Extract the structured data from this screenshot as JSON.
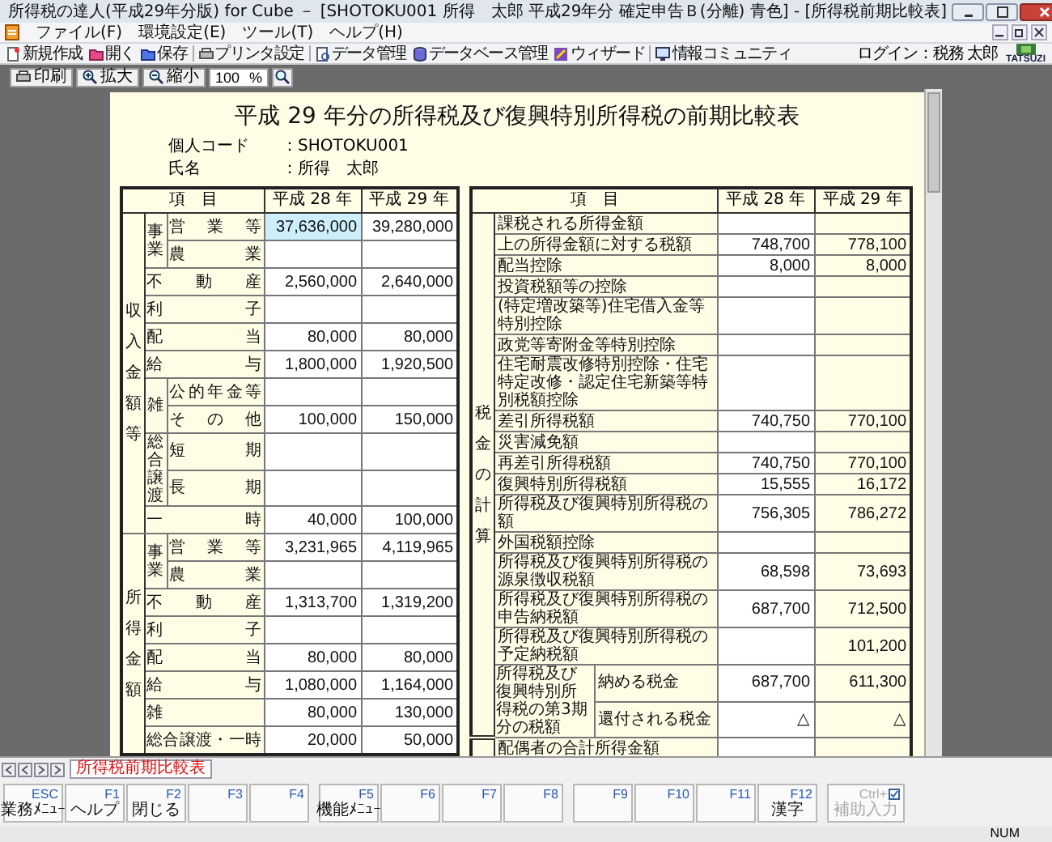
{
  "window": {
    "title": "所得税の達人(平成29年分版) for Cube － [SHOTOKU001 所得　太郎 平成29年分 確定申告Ｂ(分離) 青色] - [所得税前期比較表]"
  },
  "menu": [
    "ファイル(F)",
    "環境設定(E)",
    "ツール(T)",
    "ヘルプ(H)"
  ],
  "toolbar": {
    "groups": [
      {
        "items": [
          "新規作成",
          "開く",
          "保存"
        ]
      },
      {
        "items": [
          "プリンタ設定"
        ]
      },
      {
        "items": [
          "データ管理",
          "データベース管理",
          "ウィザード"
        ]
      },
      {
        "items": [
          "情報コミュニティ"
        ]
      }
    ],
    "login": "ログイン：税務 太郎",
    "logo": "TATSUZI"
  },
  "view_toolbar": {
    "buttons": [
      "印刷",
      "拡大",
      "縮小"
    ],
    "zoom": "100",
    "unit": "%"
  },
  "report": {
    "title": "平成 29 年分の所得税及び復興特別所得税の前期比較表",
    "info": [
      {
        "label": "個人コード",
        "value": "：SHOTOKU001"
      },
      {
        "label": "氏名",
        "value": "：所得　太郎"
      }
    ],
    "left_table": {
      "columns": [
        "項　目",
        "平成 28 年",
        "平成 29 年"
      ],
      "sections": [
        {
          "label": "収入金額等",
          "rows": [
            {
              "kind": "group",
              "label": "事業",
              "rows": [
                {
                  "item": "営業等",
                  "year_28": "37,636,000",
                  "year_29": "39,280,000",
                  "selected": true
                },
                {
                  "item": "農業",
                  "selected": false
                }
              ]
            },
            {
              "kind": "single",
              "item": "不動産",
              "year_28": "2,560,000",
              "year_29": "2,640,000",
              "selected": false
            },
            {
              "kind": "single",
              "item": "利子",
              "selected": false
            },
            {
              "kind": "single",
              "item": "配当",
              "year_28": "80,000",
              "year_29": "80,000",
              "selected": false
            },
            {
              "kind": "single",
              "item": "給与",
              "year_28": "1,800,000",
              "year_29": "1,920,500",
              "selected": false
            },
            {
              "kind": "group",
              "label": "雑",
              "rows": [
                {
                  "item": "公的年金等",
                  "selected": false
                },
                {
                  "item": "その他",
                  "year_28": "100,000",
                  "year_29": "150,000",
                  "selected": false
                }
              ]
            },
            {
              "kind": "group",
              "label": "総合譲渡",
              "rows": [
                {
                  "item": "短期",
                  "selected": false
                },
                {
                  "item": "長期",
                  "selected": false
                }
              ]
            },
            {
              "kind": "single",
              "item": "一時",
              "year_28": "40,000",
              "year_29": "100,000",
              "selected": false
            }
          ]
        },
        {
          "label": "所得金額",
          "rows": [
            {
              "kind": "group",
              "label": "事業",
              "rows": [
                {
                  "item": "営業等",
                  "year_28": "3,231,965",
                  "year_29": "4,119,965",
                  "selected": false
                },
                {
                  "item": "農業",
                  "selected": false
                }
              ]
            },
            {
              "kind": "single",
              "item": "不動産",
              "year_28": "1,313,700",
              "year_29": "1,319,200",
              "selected": false
            },
            {
              "kind": "single",
              "item": "利子",
              "selected": false
            },
            {
              "kind": "single",
              "item": "配当",
              "year_28": "80,000",
              "year_29": "80,000",
              "selected": false
            },
            {
              "kind": "single",
              "item": "給与",
              "year_28": "1,080,000",
              "year_29": "1,164,000",
              "selected": false
            },
            {
              "kind": "single",
              "item": "雑",
              "year_28": "80,000",
              "year_29": "130,000",
              "selected": false
            },
            {
              "kind": "single",
              "item": "総合譲渡・一時",
              "year_28": "20,000",
              "year_29": "50,000",
              "selected": false
            }
          ]
        }
      ]
    },
    "right_table": {
      "columns": [
        "項　目",
        "平成 28 年",
        "平成 29 年"
      ],
      "sections": [
        {
          "label": "税金の計算",
          "rows": [
            {
              "kind": "single",
              "item": "課税される所得金額"
            },
            {
              "kind": "single",
              "item": "上の所得金額に対する税額",
              "year_28": "748,700",
              "year_29": "778,100"
            },
            {
              "kind": "single",
              "item": "配当控除",
              "year_28": "8,000",
              "year_29": "8,000"
            },
            {
              "kind": "single",
              "item": "投資税額等の控除"
            },
            {
              "kind": "single",
              "item": "(特定増改築等)住宅借入金等特別控除"
            },
            {
              "kind": "single",
              "item": "政党等寄附金等特別控除"
            },
            {
              "kind": "single",
              "item": "住宅耐震改修特別控除・住宅特定改修・認定住宅新築等特別税額控除"
            },
            {
              "kind": "single",
              "item": "差引所得税額",
              "year_28": "740,750",
              "year_29": "770,100"
            },
            {
              "kind": "single",
              "item": "災害減免額"
            },
            {
              "kind": "single",
              "item": "再差引所得税額",
              "year_28": "740,750",
              "year_29": "770,100"
            },
            {
              "kind": "single",
              "item": "復興特別所得税額",
              "year_28": "15,555",
              "year_29": "16,172"
            },
            {
              "kind": "single",
              "item": "所得税及び復興特別所得税の額",
              "year_28": "756,305",
              "year_29": "786,272"
            },
            {
              "kind": "single",
              "item": "外国税額控除"
            },
            {
              "kind": "single",
              "item": "所得税及び復興特別所得税の源泉徴収税額",
              "year_28": "68,598",
              "year_29": "73,693"
            },
            {
              "kind": "single",
              "item": "所得税及び復興特別所得税の申告納税額",
              "year_28": "687,700",
              "year_29": "712,500"
            },
            {
              "kind": "single",
              "item": "所得税及び復興特別所得税の予定納税額",
              "year_29": "101,200"
            },
            {
              "kind": "group",
              "label": "所得税及び復興特別所得税の第3期分の税額",
              "rows": [
                {
                  "item": "納める税金",
                  "year_28": "687,700",
                  "year_29": "611,300"
                },
                {
                  "item": "還付される税金",
                  "year_28": "△",
                  "year_29": "△"
                }
              ]
            }
          ]
        },
        {
          "rows": [
            {
              "kind": "single",
              "item": "配偶者の合計所得金額"
            }
          ]
        }
      ]
    }
  },
  "sheet_tabs": [
    {
      "label": "所得税前期比較表",
      "selected": true
    }
  ],
  "function_keys": {
    "groups": [
      {
        "keys": [
          {
            "kind": "fkey",
            "key": "ESC",
            "label": "業務ﾒﾆｭｰ",
            "disabled": false
          },
          {
            "kind": "fkey",
            "key": "F1",
            "label": "ヘルプ",
            "disabled": false
          },
          {
            "kind": "fkey",
            "key": "F2",
            "label": "閉じる",
            "disabled": false
          },
          {
            "kind": "fkey",
            "key": "F3",
            "disabled": false
          },
          {
            "kind": "fkey",
            "key": "F4",
            "disabled": false
          }
        ]
      },
      {
        "keys": [
          {
            "kind": "fkey",
            "key": "F5",
            "label": "機能ﾒﾆｭｰ",
            "disabled": false
          },
          {
            "kind": "fkey",
            "key": "F6",
            "disabled": false
          },
          {
            "kind": "fkey",
            "key": "F7",
            "disabled": false
          },
          {
            "kind": "fkey",
            "key": "F8",
            "disabled": false
          }
        ]
      },
      {
        "keys": [
          {
            "kind": "fkey",
            "key": "F9",
            "disabled": false
          },
          {
            "kind": "fkey",
            "key": "F10",
            "disabled": false
          },
          {
            "kind": "fkey",
            "key": "F11",
            "disabled": false
          },
          {
            "kind": "fkey",
            "key": "F12",
            "label": "漢字",
            "disabled": false
          }
        ]
      },
      {
        "keys": [
          {
            "kind": "modifier",
            "key": "Ctrl+",
            "label": "補助入力",
            "disabled": true
          }
        ]
      }
    ]
  },
  "status_bar": {
    "indicator": "NUM"
  }
}
